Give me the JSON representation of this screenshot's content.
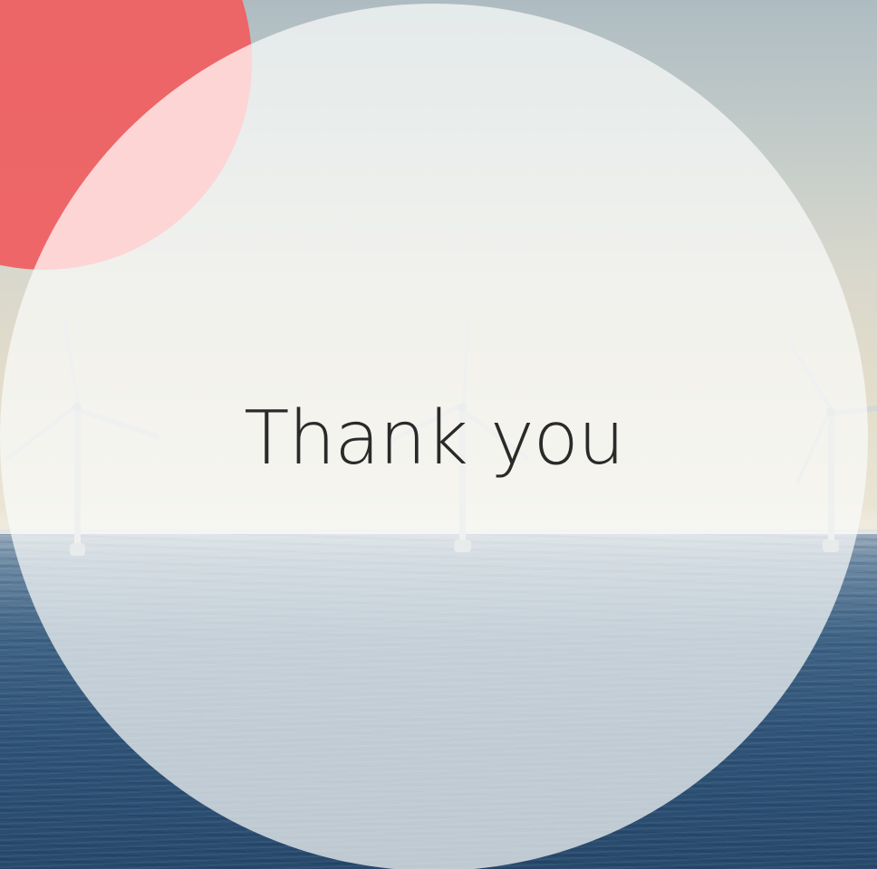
{
  "slide": {
    "title": "Thank you"
  },
  "colors": {
    "accent_red": "#ef6062",
    "overlay_white": "#fafbfa",
    "sea_blue": "#2f5478",
    "sky": "#d9d8cc",
    "text": "#2a2a2a"
  },
  "icons": [
    "wind-turbine-icon"
  ]
}
